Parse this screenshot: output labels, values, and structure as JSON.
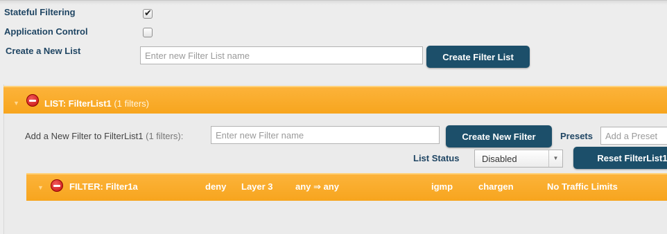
{
  "settings": {
    "stateful_filtering_label": "Stateful Filtering",
    "stateful_filtering_checked": true,
    "application_control_label": "Application Control",
    "application_control_checked": false,
    "create_list_label": "Create a New List",
    "new_list_placeholder": "Enter new Filter List name",
    "create_list_button": "Create Filter List"
  },
  "list": {
    "title": "LIST: FilterList1",
    "count": "(1 filters)",
    "add_filter_label": "Add a New Filter to FilterList1",
    "add_filter_count": "(1 filters):",
    "new_filter_placeholder": "Enter new Filter name",
    "create_filter_button": "Create New Filter",
    "presets_label": "Presets",
    "presets_placeholder": "Add a Preset",
    "list_status_label": "List Status",
    "list_status_value": "Disabled",
    "reset_button": "Reset FilterList1"
  },
  "filter": {
    "name": "FILTER: Filter1a",
    "action": "deny",
    "layer": "Layer 3",
    "direction": "any ⇒ any",
    "protocol": "igmp",
    "port": "chargen",
    "traffic": "No Traffic Limits"
  },
  "colors": {
    "accent": "#1c4f6a",
    "header_orange": "#f9ab29",
    "remove_red": "#c61010",
    "label_blue": "#1f4563"
  },
  "icons": {
    "remove": "minus-circle-icon",
    "collapse": "caret-down-icon",
    "check": "checkmark-icon",
    "dropdown": "chevron-down-icon"
  }
}
